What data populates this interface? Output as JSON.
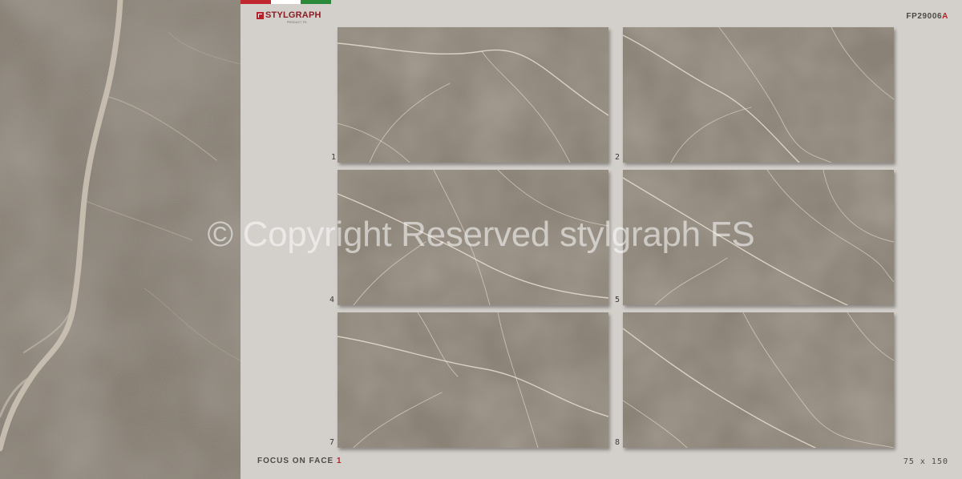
{
  "brand": {
    "logo_text": "STYLGRAPH",
    "logo_sub": "PRODUCT FS",
    "flag_colors": [
      "#c0262e",
      "#ffffff",
      "#2a8a3a"
    ]
  },
  "product_code": {
    "prefix": "FP29006",
    "suffix": "A",
    "accent_color": "#b8202a"
  },
  "tiles": [
    {
      "number": "1"
    },
    {
      "number": "2"
    },
    {
      "number": "4"
    },
    {
      "number": "5"
    },
    {
      "number": "7"
    },
    {
      "number": "8"
    }
  ],
  "focus_label": {
    "text": "FOCUS ON FACE",
    "face_number": "1"
  },
  "size_label": "75 x 150",
  "watermark": "© Copyright Reserved stylgraph FS",
  "colors": {
    "stone_base": "#847c72",
    "background": "#d3cfca",
    "vein": "#e8e0d4"
  }
}
